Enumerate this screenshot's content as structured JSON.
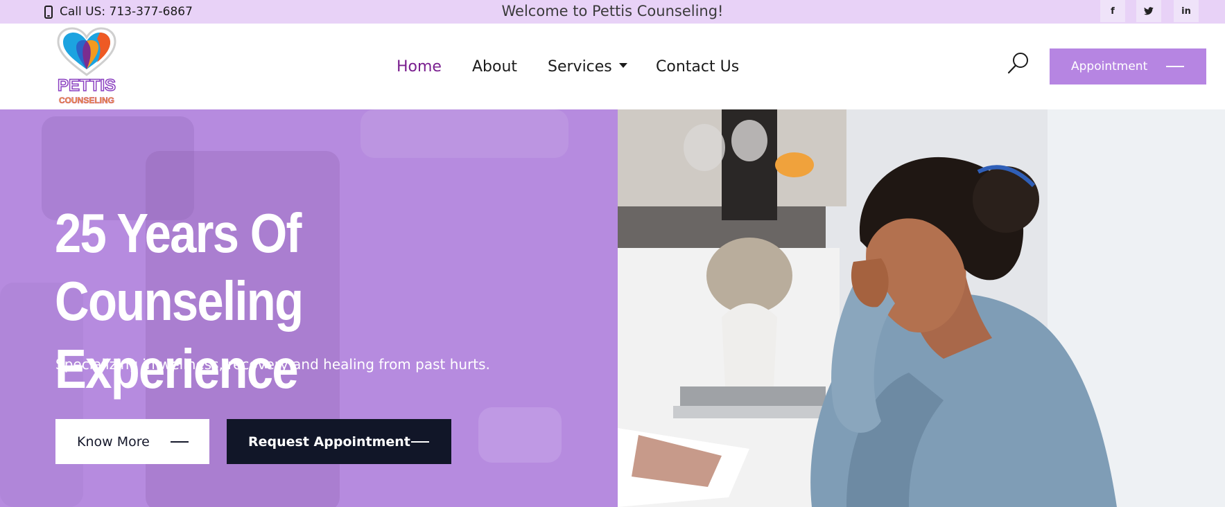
{
  "topbar": {
    "call_label": "Call US: 713-377-6867",
    "welcome": "Welcome to Pettis Counseling!",
    "social": {
      "facebook": "f",
      "twitter": "t",
      "linkedin": "in"
    }
  },
  "logo": {
    "line1": "PETTIS",
    "line2": "COUNSELING"
  },
  "nav": {
    "home": "Home",
    "about": "About",
    "services": "Services",
    "contact": "Contact Us"
  },
  "header": {
    "appointment_label": "Appointment"
  },
  "hero": {
    "title_line1": "25 Years Of Counseling",
    "title_line2": "Experience",
    "subtitle": "Specializing in wellness, recovery and healing from past hurts.",
    "know_more": "Know More",
    "request": "Request Appointment"
  },
  "colors": {
    "topbar_bg": "#e8d2f7",
    "accent_purple": "#b685e2",
    "active_nav": "#7a1f8f",
    "dark_button": "#111628"
  },
  "icons": [
    "phone-icon",
    "facebook-icon",
    "twitter-icon",
    "linkedin-icon",
    "search-icon",
    "dash-icon",
    "caret-down-icon",
    "logo-heart"
  ]
}
